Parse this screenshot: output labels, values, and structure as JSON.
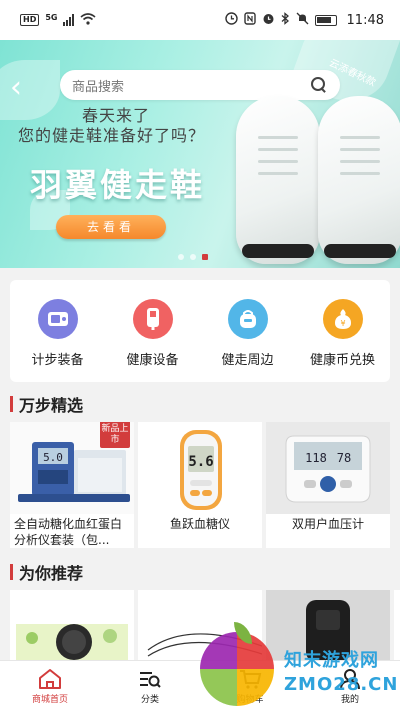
{
  "status_bar": {
    "hd": "HD",
    "net": "5G",
    "time": "11:48"
  },
  "banner": {
    "search_placeholder": "商品搜索",
    "corner_tag": "云添春秋款",
    "slogan_line1": "春天来了",
    "slogan_line2": "您的健走鞋准备好了吗？",
    "title": "羽翼健走鞋",
    "cta_label": "去看看",
    "page_index": 3,
    "page_count": 3
  },
  "categories": [
    {
      "label": "计步装备",
      "icon": "pedometer-icon",
      "color": "#7d7fe0"
    },
    {
      "label": "健康设备",
      "icon": "health-device-icon",
      "color": "#f06262"
    },
    {
      "label": "健走周边",
      "icon": "walking-bag-icon",
      "color": "#52b6e8"
    },
    {
      "label": "健康币兑换",
      "icon": "coin-exchange-icon",
      "color": "#f5a623"
    }
  ],
  "sections": {
    "featured": "万步精选",
    "recommend": "为你推荐"
  },
  "products": [
    {
      "name": "全自动糖化血红蛋白分析仪套装（包...",
      "badge": "新品上市",
      "icon": "hba1c-analyzer-icon"
    },
    {
      "name": "鱼跃血糖仪",
      "icon": "glucose-meter-icon",
      "screen": "5.6"
    },
    {
      "name": "双用户血压计",
      "icon": "blood-pressure-monitor-icon",
      "screen": "118"
    }
  ],
  "tabs": [
    {
      "label": "商城首页",
      "icon": "home-icon",
      "active": true
    },
    {
      "label": "分类",
      "icon": "category-icon",
      "active": false
    },
    {
      "label": "购物车",
      "icon": "cart-icon",
      "active": false
    },
    {
      "label": "我的",
      "icon": "profile-icon",
      "active": false
    }
  ],
  "watermark": {
    "line1": "知末游戏网",
    "line2": "ZMO28.CN"
  },
  "colors": {
    "accent": "#d23c3c",
    "banner_teal": "#8fe6d8",
    "cta_orange": "#f5882c"
  }
}
